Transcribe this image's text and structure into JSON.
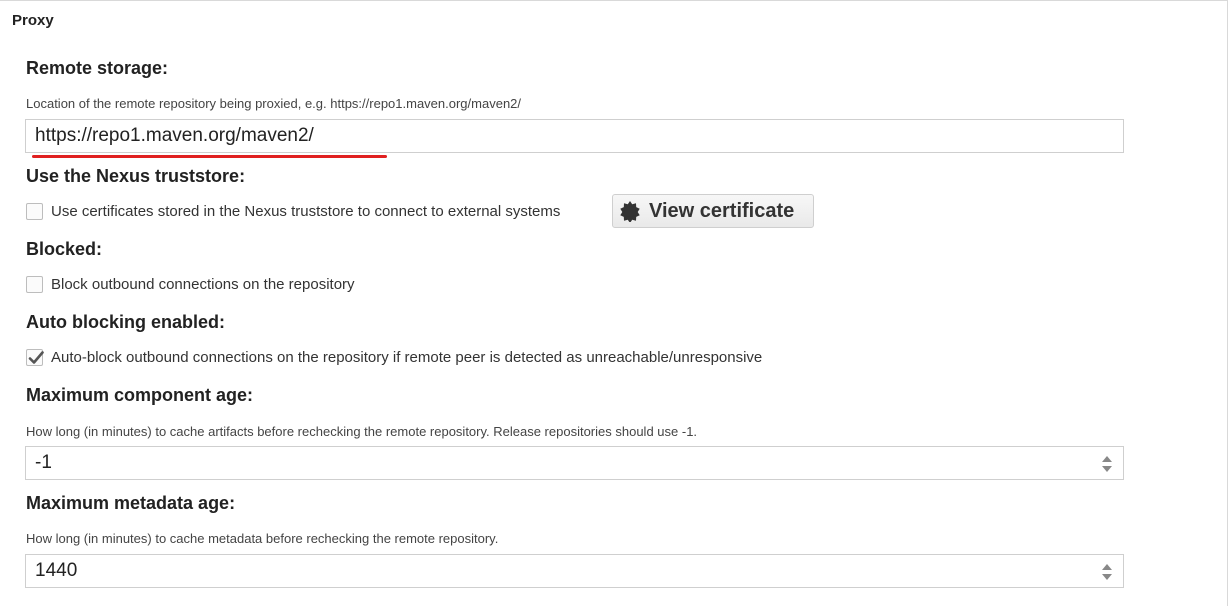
{
  "panel": {
    "title": "Proxy"
  },
  "remote_storage": {
    "label": "Remote storage:",
    "help": "Location of the remote repository being proxied, e.g. https://repo1.maven.org/maven2/",
    "value": "https://repo1.maven.org/maven2/"
  },
  "truststore": {
    "label": "Use the Nexus truststore:",
    "checkbox_label": "Use certificates stored in the Nexus truststore to connect to external systems",
    "checked": false,
    "button_label": "View certificate",
    "button_icon": "certificate-icon"
  },
  "blocked": {
    "label": "Blocked:",
    "checkbox_label": "Block outbound connections on the repository",
    "checked": false
  },
  "auto_blocking": {
    "label": "Auto blocking enabled:",
    "checkbox_label": "Auto-block outbound connections on the repository if remote peer is detected as unreachable/unresponsive",
    "checked": true
  },
  "max_component_age": {
    "label": "Maximum component age:",
    "help": "How long (in minutes) to cache artifacts before rechecking the remote repository. Release repositories should use -1.",
    "value": "-1"
  },
  "max_metadata_age": {
    "label": "Maximum metadata age:",
    "help": "How long (in minutes) to cache metadata before rechecking the remote repository.",
    "value": "1440"
  },
  "colors": {
    "annotation_underline": "#e02020",
    "border": "#cfcfcf",
    "checkmark": "#555555"
  }
}
